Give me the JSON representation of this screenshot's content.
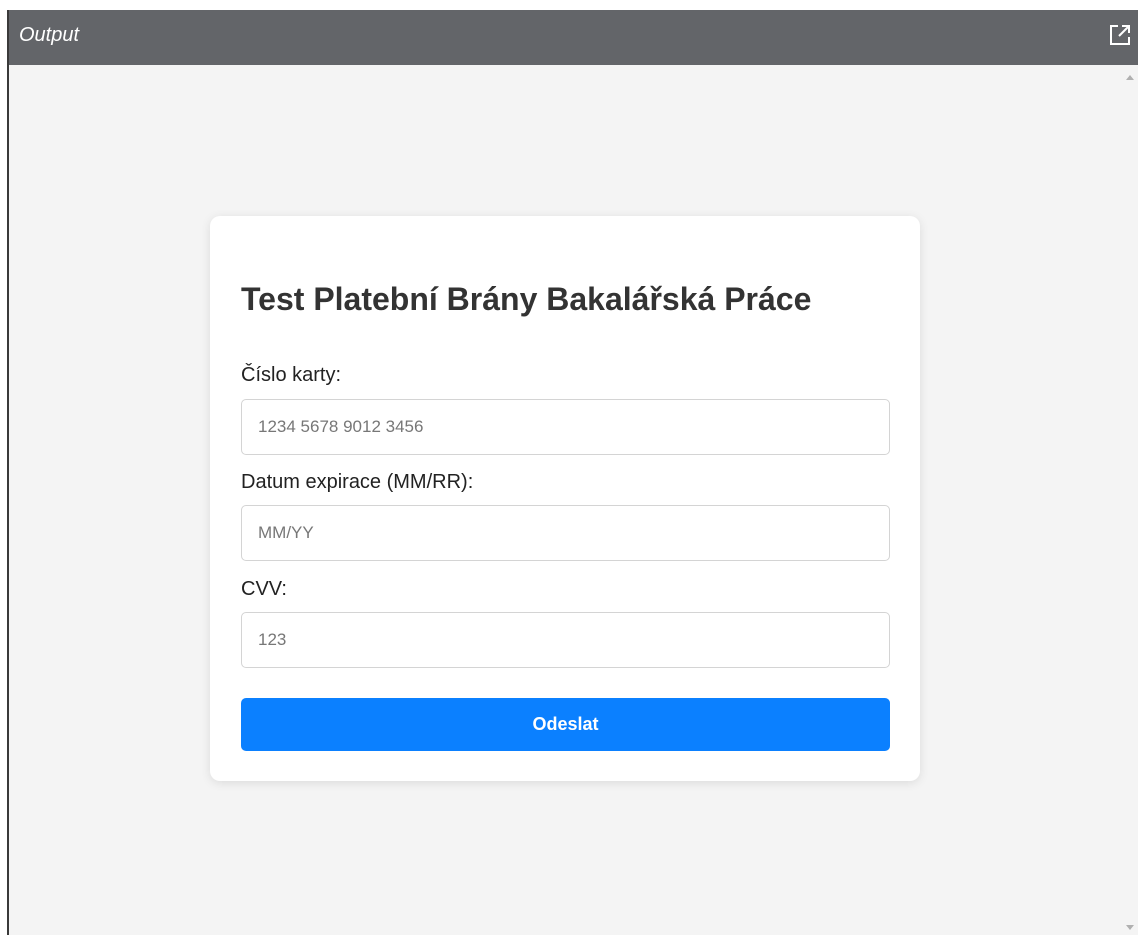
{
  "window": {
    "title": "Output",
    "popout_icon": "external-link-icon"
  },
  "form": {
    "heading": "Test Platební Brány Bakalářská Práce",
    "card_number": {
      "label": "Číslo karty:",
      "placeholder": "1234 5678 9012 3456",
      "value": ""
    },
    "expiry": {
      "label": "Datum expirace (MM/RR):",
      "placeholder": "MM/YY",
      "value": ""
    },
    "cvv": {
      "label": "CVV:",
      "placeholder": "123",
      "value": ""
    },
    "submit_label": "Odeslat"
  },
  "colors": {
    "titlebar": "#636569",
    "viewport_bg": "#f4f4f4",
    "button": "#0b80ff",
    "heading": "#333333"
  }
}
